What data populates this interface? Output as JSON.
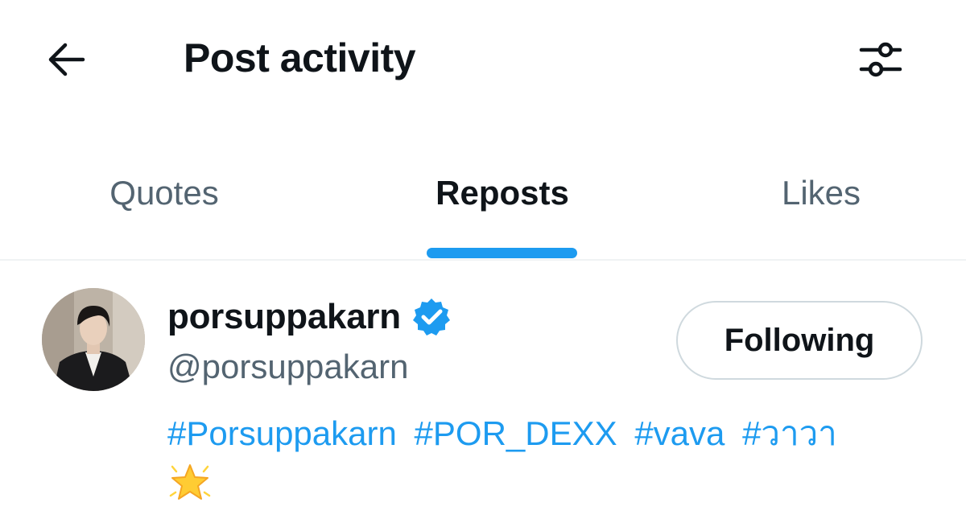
{
  "header": {
    "title": "Post activity",
    "back_icon": "arrow-left-icon",
    "filter_icon": "sliders-icon"
  },
  "tabs": [
    {
      "label": "Quotes",
      "active": false
    },
    {
      "label": "Reposts",
      "active": true
    },
    {
      "label": "Likes",
      "active": false
    }
  ],
  "user": {
    "display_name": "porsuppakarn",
    "verified": true,
    "handle": "@porsuppakarn",
    "follow_button_label": "Following",
    "bio_tags": [
      "#Porsuppakarn",
      "#POR_DEXX",
      "#vava",
      "#วาวา"
    ],
    "bio_emoji": "star-icon"
  },
  "colors": {
    "accent": "#1d9bf0",
    "text_primary": "#0f1419",
    "text_secondary": "#536471",
    "divider": "#eff3f4",
    "button_border": "#cfd9de"
  }
}
